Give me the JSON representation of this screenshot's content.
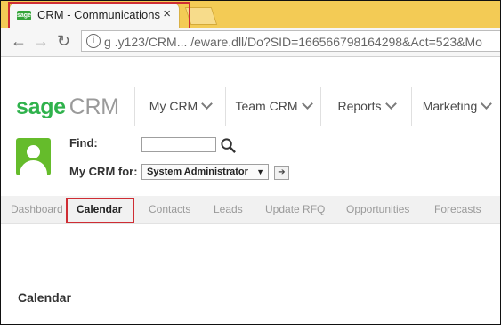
{
  "browser": {
    "tab_title": "CRM - Communications",
    "tab_close": "×",
    "favicon_text": "sage",
    "nav": {
      "back": "←",
      "forward": "→",
      "reload": "↻"
    },
    "info_icon": "i",
    "url": "g  .y123/CRM...  /eware.dll/Do?SID=166566798164298&Act=523&Mo"
  },
  "app": {
    "logo_sage": "sage",
    "logo_crm": "CRM",
    "menu": [
      {
        "label": "My CRM"
      },
      {
        "label": "Team CRM"
      },
      {
        "label": "Reports"
      },
      {
        "label": "Marketing"
      }
    ],
    "find_label": "Find:",
    "find_value": "",
    "mycrm_label": "My CRM for:",
    "user_select_value": "System Administrator",
    "select_arrow": "▼",
    "go_icon": "➔",
    "subnav": [
      {
        "label": "Dashboard"
      },
      {
        "label": "Calendar"
      },
      {
        "label": "Contacts"
      },
      {
        "label": "Leads"
      },
      {
        "label": "Update RFQ"
      },
      {
        "label": "Opportunities"
      },
      {
        "label": "Forecasts"
      }
    ],
    "content_title": "Calendar"
  },
  "colors": {
    "tabstrip": "#f3cb55",
    "highlight": "#cf2d34",
    "brand_green": "#2fb24c",
    "avatar_green": "#65bc2b"
  }
}
